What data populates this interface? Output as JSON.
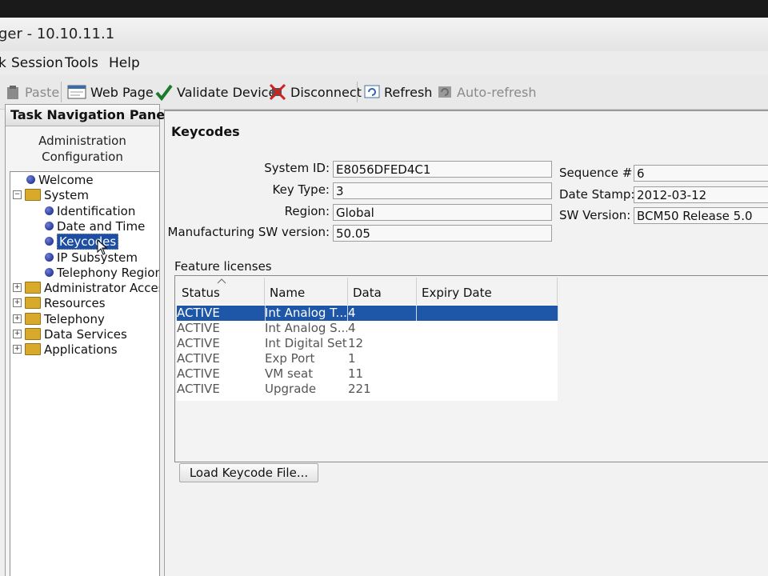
{
  "window": {
    "title": "ger - 10.10.11.1"
  },
  "menu": {
    "items": [
      "k",
      "Session",
      "Tools",
      "Help"
    ]
  },
  "toolbar": {
    "paste": "Paste",
    "web_page": "Web Page",
    "validate": "Validate Device",
    "disconnect": "Disconnect",
    "refresh": "Refresh",
    "auto_refresh": "Auto-refresh"
  },
  "nav": {
    "header": "Task Navigation Panel",
    "tabs": [
      "Administration",
      "Configuration"
    ],
    "tree": {
      "welcome": "Welcome",
      "system": "System",
      "system_children": [
        "Identification",
        "Date and Time",
        "Keycodes",
        "IP Subsystem",
        "Telephony Region"
      ],
      "folders": [
        "Administrator Access",
        "Resources",
        "Telephony",
        "Data Services",
        "Applications"
      ],
      "selected": "Keycodes"
    }
  },
  "keycodes": {
    "title": "Keycodes",
    "fields": {
      "system_id": {
        "label": "System ID:",
        "value": "E8056DFED4C1"
      },
      "key_type": {
        "label": "Key Type:",
        "value": "3"
      },
      "region": {
        "label": "Region:",
        "value": "Global"
      },
      "mfg_sw": {
        "label": "Manufacturing SW version:",
        "value": "50.05"
      },
      "sequence": {
        "label": "Sequence #:",
        "value": "6"
      },
      "date_stamp": {
        "label": "Date Stamp:",
        "value": "2012-03-12"
      },
      "sw_version": {
        "label": "SW Version:",
        "value": "BCM50 Release 5.0"
      }
    },
    "licenses_title": "Feature licenses",
    "columns": [
      "Status",
      "Name",
      "Data",
      "Expiry Date"
    ],
    "rows": [
      {
        "status": "ACTIVE",
        "name": "Int Analog T...",
        "data": "4",
        "expiry": ""
      },
      {
        "status": "ACTIVE",
        "name": "Int Analog S...",
        "data": "4",
        "expiry": ""
      },
      {
        "status": "ACTIVE",
        "name": "Int Digital Sets",
        "data": "12",
        "expiry": ""
      },
      {
        "status": "ACTIVE",
        "name": "Exp Port",
        "data": "1",
        "expiry": ""
      },
      {
        "status": "ACTIVE",
        "name": "VM seat",
        "data": "11",
        "expiry": ""
      },
      {
        "status": "ACTIVE",
        "name": "Upgrade",
        "data": "221",
        "expiry": ""
      }
    ],
    "load_button": "Load Keycode File..."
  }
}
